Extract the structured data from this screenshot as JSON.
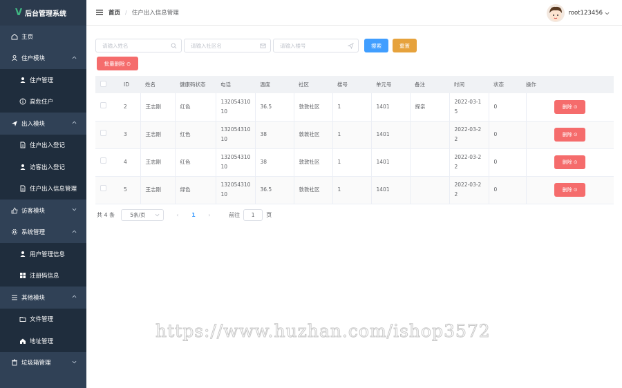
{
  "app": {
    "logo_mark": "V",
    "title": "后台管理系统"
  },
  "sidebar": [
    {
      "label": "主页",
      "type": "top",
      "icon": "home-icon",
      "arrow": ""
    },
    {
      "label": "住户模块",
      "type": "top",
      "icon": "user-icon",
      "arrow": "⌃"
    },
    {
      "label": "住户管理",
      "type": "sub",
      "icon": "person-icon",
      "arrow": ""
    },
    {
      "label": "高危住户",
      "type": "sub",
      "icon": "info-icon",
      "arrow": ""
    },
    {
      "label": "出入模块",
      "type": "top",
      "icon": "send-icon",
      "arrow": "⌃"
    },
    {
      "label": "住户出入登记",
      "type": "sub",
      "icon": "document-icon",
      "arrow": ""
    },
    {
      "label": "访客出入登记",
      "type": "sub",
      "icon": "person-icon",
      "arrow": ""
    },
    {
      "label": "住户出入信息管理",
      "type": "sub",
      "icon": "document-icon",
      "arrow": ""
    },
    {
      "label": "访客模块",
      "type": "top",
      "icon": "thumb-icon",
      "arrow": "⌄"
    },
    {
      "label": "系统管理",
      "type": "top",
      "icon": "gear-icon",
      "arrow": "⌃"
    },
    {
      "label": "用户管理信息",
      "type": "sub",
      "icon": "person-icon",
      "arrow": ""
    },
    {
      "label": "注册码信息",
      "type": "sub",
      "icon": "grid-icon",
      "arrow": ""
    },
    {
      "label": "其他模块",
      "type": "top",
      "icon": "list-icon",
      "arrow": "⌃"
    },
    {
      "label": "文件管理",
      "type": "sub",
      "icon": "folder-icon",
      "arrow": ""
    },
    {
      "label": "地址管理",
      "type": "sub",
      "icon": "house-icon",
      "arrow": ""
    },
    {
      "label": "垃圾箱管理",
      "type": "top",
      "icon": "trash-icon",
      "arrow": "⌄"
    }
  ],
  "header": {
    "home": "首页",
    "separator": "/",
    "current": "住户出入信息管理",
    "username": "root123456"
  },
  "filters": {
    "name_placeholder": "请输入姓名",
    "community_placeholder": "请输入社区名",
    "building_placeholder": "请输入楼号",
    "search_label": "搜索",
    "reset_label": "重置",
    "batch_delete_label": "批量删除 ⊙"
  },
  "table": {
    "headers": [
      "ID",
      "姓名",
      "健康码状态",
      "电话",
      "温度",
      "社区",
      "楼号",
      "单元号",
      "备注",
      "时间",
      "状态",
      "操作"
    ],
    "rows": [
      {
        "id": "2",
        "name": "王志刚",
        "health": "红色",
        "phone": "13205431010",
        "temp": "36.5",
        "community": "敦敦社区",
        "building": "1",
        "unit": "1401",
        "note": "探亲",
        "time": "2022-03-15",
        "status": "0"
      },
      {
        "id": "3",
        "name": "王志刚",
        "health": "红色",
        "phone": "13205431010",
        "temp": "38",
        "community": "敦敦社区",
        "building": "1",
        "unit": "1401",
        "note": "",
        "time": "2022-03-22",
        "status": "0"
      },
      {
        "id": "4",
        "name": "王志刚",
        "health": "红色",
        "phone": "13205431010",
        "temp": "38",
        "community": "敦敦社区",
        "building": "1",
        "unit": "1401",
        "note": "",
        "time": "2022-03-22",
        "status": "0"
      },
      {
        "id": "5",
        "name": "王志刚",
        "health": "绿色",
        "phone": "13205431010",
        "temp": "36.5",
        "community": "敦敦社区",
        "building": "1",
        "unit": "1401",
        "note": "",
        "time": "2022-03-22",
        "status": "0"
      }
    ],
    "delete_label": "删除 ⊙"
  },
  "pager": {
    "total": "共 4 条",
    "page_size": "5条/页",
    "prev": "‹",
    "current": "1",
    "next": "›",
    "goto": "前往",
    "goto_value": "1",
    "page_unit": "页"
  },
  "watermark": "https://www.huzhan.com/ishop3572",
  "colors": {
    "sidebar_bg": "#304156",
    "primary": "#409eff",
    "warning": "#e6a23c",
    "danger": "#f56c6c"
  }
}
